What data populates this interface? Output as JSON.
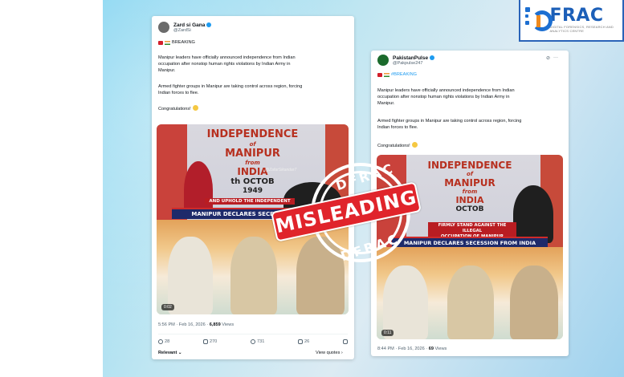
{
  "brand": {
    "logo_text": "FRAC",
    "logo_tagline": "DIGITAL FORENSICS, RESEARCH AND ANALYTICS CENTRE"
  },
  "stamp": {
    "top_word": "DFRAC",
    "bottom_word": "DFRAC",
    "label": "MISLEADING"
  },
  "tweet1": {
    "display_name": "Zard si Gana",
    "handle": "@ZardSi",
    "breaking": "BREAKING",
    "para1_lines": [
      "Manipur leaders have officially announced independence from Indian",
      "occupation after nonstop human rights violations by Indian Army in",
      "Manipur."
    ],
    "para2_lines": [
      "Armed fighter groups in Manipur are taking control across region, forcing",
      "Indian forces to flee."
    ],
    "congrats": "Congratulations!",
    "banner_lines": [
      "INDEPENDENCE",
      "of",
      "MANIPUR",
      "from",
      "INDIA",
      "th OCTOB",
      "1949"
    ],
    "watermark": "@ZafarSikandar7",
    "caption_red": "AND UPHOLD THE INDEPENDENT",
    "caption_blue": "MANIPUR DECLARES SECESSION FROM",
    "video_time": "0:02",
    "timestamp": "5:56 PM · Feb 16, 2026 · ",
    "views_count": "6,859",
    "views_label": " Views",
    "replies": "28",
    "reposts": "270",
    "likes": "731",
    "bookmarks": "26",
    "relevant": "Relevant",
    "view_quotes": "View quotes"
  },
  "tweet2": {
    "display_name": "PakistanPulse",
    "handle": "@Pakpulse247",
    "hashtag": "#BREAKING",
    "para1_lines": [
      "Manipur leaders have officially announced independence from Indian",
      "occupation after nonstop human rights violations by Indian Army in",
      "Manipur."
    ],
    "para2_lines": [
      "Armed fighter groups in Manipur are taking control across region, forcing",
      "Indian forces to flee."
    ],
    "congrats": "Congratulations!",
    "banner_lines": [
      "INDEPENDENCE",
      "of",
      "MANIPUR",
      "from",
      "INDIA",
      "OCTOB"
    ],
    "caption_red_1": "FIRMLY STAND AGAINST THE ILLEGAL",
    "caption_red_2": "OCCUPATION OF MANIPUR",
    "caption_blue": "MANIPUR DECLARES SECESSION FROM INDIA",
    "video_time": "0:11",
    "timestamp": "8:44 PM · Feb 16, 2026 · ",
    "views_count": "69",
    "views_label": " Views"
  }
}
